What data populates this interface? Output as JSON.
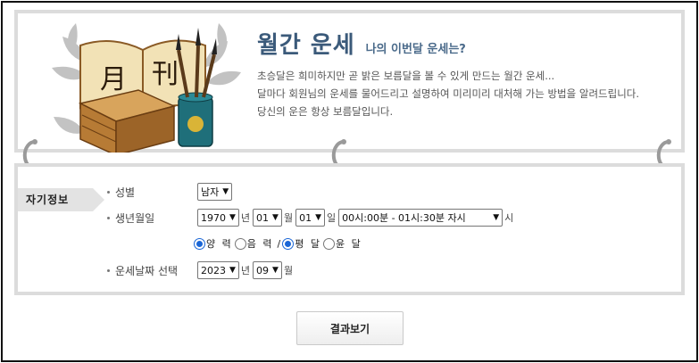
{
  "banner": {
    "title": "월간 운세",
    "subtitle": "나의 이번달 운세는?",
    "desc_line1": "초승달은 희미하지만 곧 밝은 보름달을 볼 수 있게 만드는 월간 운세...",
    "desc_line2": "달마다 회원님의 운세를 물어드리고 설명하여 미리미리 대처해 가는 방법을 알려드립니다.",
    "desc_line3": "당신의 운은 항상 보름달입니다.",
    "book_chars": [
      "月",
      "刊"
    ]
  },
  "form": {
    "section_tag": "자기정보",
    "gender": {
      "label": "성별",
      "value": "남자"
    },
    "birth": {
      "label": "생년월일",
      "year": "1970",
      "year_unit": "년",
      "month": "01",
      "month_unit": "월",
      "day": "01",
      "day_unit": "일",
      "time": "00시:00분 - 01시:30분 자시",
      "time_unit": "시"
    },
    "calendar": {
      "solar": "양 력",
      "lunar": "음 력",
      "slash": "/",
      "normal": "평 달",
      "leap": "윤 달",
      "solar_checked": true,
      "normal_checked": true
    },
    "target": {
      "label": "운세날짜 선택",
      "year": "2023",
      "year_unit": "년",
      "month": "09",
      "month_unit": "월"
    }
  },
  "submit_label": "결과보기",
  "colors": {
    "title": "#3b5a7a",
    "panel_border": "#dcdcdc",
    "radio": "#1a66d6"
  }
}
